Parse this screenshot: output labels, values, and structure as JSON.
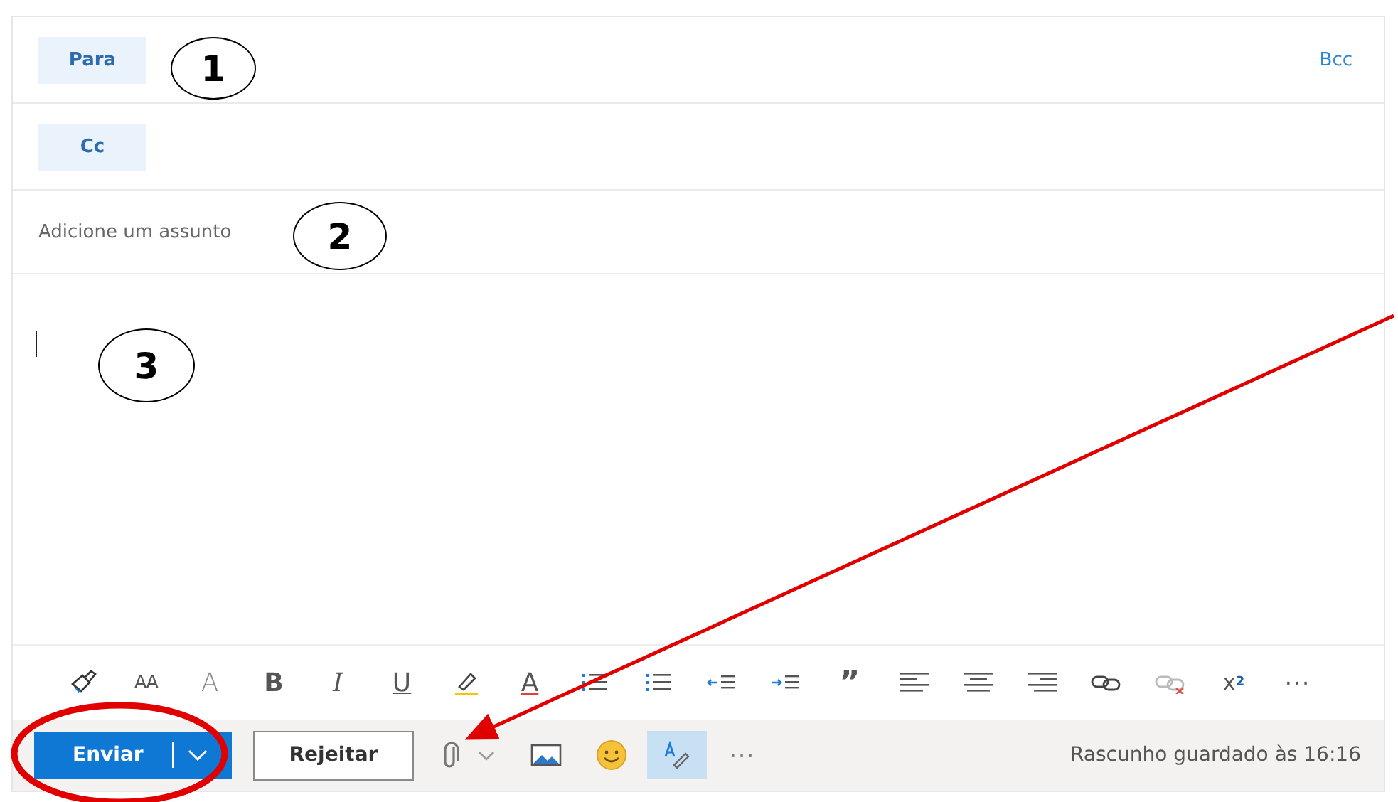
{
  "recipients": [
    {
      "label": "Para"
    },
    {
      "label": "Cc"
    }
  ],
  "bcc_link": "Bcc",
  "subject": {
    "placeholder": "Adicione um assunto"
  },
  "format_toolbar": [
    {
      "kind": "paint-format"
    },
    {
      "kind": "font-size",
      "glyph": "AA"
    },
    {
      "kind": "change-case",
      "glyph": "A"
    },
    {
      "kind": "bold",
      "glyph": "B"
    },
    {
      "kind": "italic",
      "glyph": "I"
    },
    {
      "kind": "underline",
      "glyph": "U"
    },
    {
      "kind": "highlight"
    },
    {
      "kind": "font-color",
      "glyph": "A"
    },
    {
      "kind": "bullets"
    },
    {
      "kind": "numbering"
    },
    {
      "kind": "outdent"
    },
    {
      "kind": "indent"
    },
    {
      "kind": "quote",
      "glyph": "”"
    },
    {
      "kind": "align-left"
    },
    {
      "kind": "align-center"
    },
    {
      "kind": "align-right"
    },
    {
      "kind": "link"
    },
    {
      "kind": "unlink",
      "disabled": true
    },
    {
      "kind": "superscript",
      "glyph": "x$^{2}$"
    },
    {
      "kind": "more",
      "glyph": "···"
    }
  ],
  "send_button": {
    "label": "Enviar"
  },
  "discard_button": {
    "label": "Rejeitar"
  },
  "bottom_tools": [
    {
      "kind": "attach",
      "selected": false
    },
    {
      "kind": "image",
      "selected": false
    },
    {
      "kind": "emoji",
      "selected": false
    },
    {
      "kind": "editor",
      "selected": true
    },
    {
      "kind": "more",
      "glyph": "···",
      "selected": false
    }
  ],
  "status": "Rascunho guardado às 16:16",
  "annotations": [
    {
      "kind": "number",
      "label": "1"
    },
    {
      "kind": "number",
      "label": "2"
    },
    {
      "kind": "number",
      "label": "3"
    },
    {
      "kind": "ellipse"
    },
    {
      "kind": "arrow"
    }
  ]
}
